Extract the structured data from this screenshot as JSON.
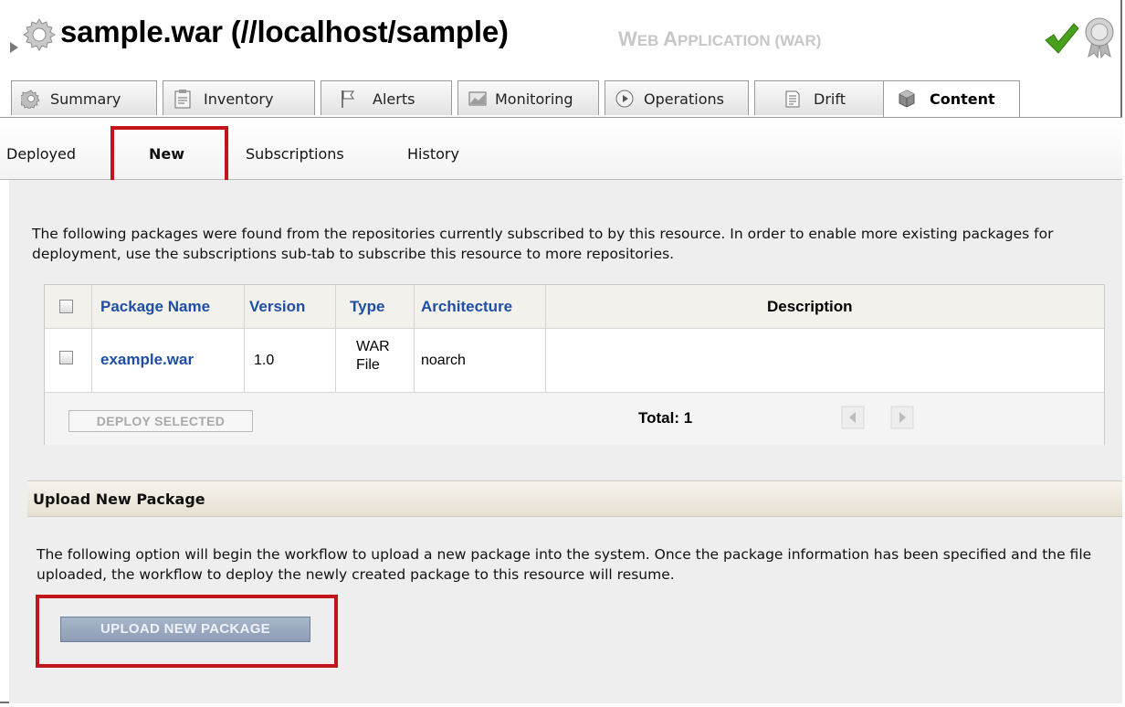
{
  "header": {
    "title": "sample.war (//localhost/sample)",
    "subtitle_lead_1": "W",
    "subtitle_rest_1": "EB ",
    "subtitle_lead_2": "A",
    "subtitle_rest_2": "PPLICATION (WAR)",
    "status_icon": "green-checkmark",
    "availability_icon": "gray-badge"
  },
  "tabs": [
    {
      "label": "Summary",
      "icon": "gear-icon"
    },
    {
      "label": "Inventory",
      "icon": "clipboard-icon"
    },
    {
      "label": "Alerts",
      "icon": "flag-icon"
    },
    {
      "label": "Monitoring",
      "icon": "chart-icon"
    },
    {
      "label": "Operations",
      "icon": "play-icon"
    },
    {
      "label": "Drift",
      "icon": "document-icon"
    },
    {
      "label": "Content",
      "icon": "box-icon",
      "active": true
    }
  ],
  "subtabs": [
    {
      "label": "Deployed"
    },
    {
      "label": "New",
      "active": true
    },
    {
      "label": "Subscriptions"
    },
    {
      "label": "History"
    }
  ],
  "intro_text": "The following packages were found from the repositories currently subscribed to by this resource. In order to enable more existing packages for deployment, use the subscriptions sub-tab to subscribe this resource to more repositories.",
  "table": {
    "columns": [
      "Package Name",
      "Version",
      "Type",
      "Architecture",
      "Description"
    ],
    "rows": [
      {
        "package_name": "example.war",
        "version": "1.0",
        "type_line1": "WAR",
        "type_line2": "File",
        "architecture": "noarch",
        "description": ""
      }
    ],
    "deploy_button": "DEPLOY SELECTED",
    "total": "Total: 1"
  },
  "upload": {
    "header": "Upload New Package",
    "text": "The following option will begin the workflow to upload a new package into the system. Once the package information has been specified and the file uploaded, the workflow to deploy the newly created package to this resource will resume.",
    "button": "UPLOAD NEW PACKAGE"
  },
  "colors": {
    "link": "#1f4ea6",
    "highlight": "#c4141b",
    "check": "#49a01c"
  }
}
